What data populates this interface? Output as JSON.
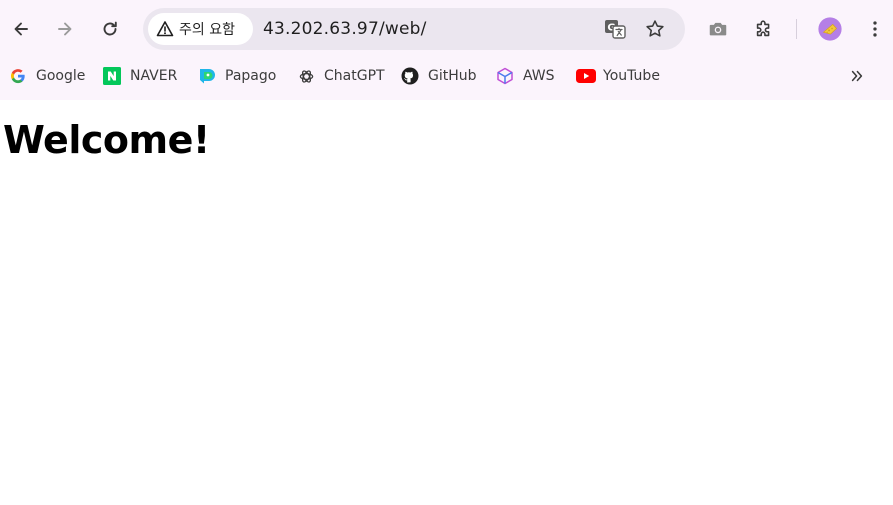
{
  "toolbar": {
    "back_icon": "arrow-left-icon",
    "forward_icon": "arrow-right-icon",
    "reload_icon": "reload-icon",
    "security_chip_label": "주의 요함",
    "security_icon": "warning-triangle-icon",
    "url": "43.202.63.97/web/",
    "translate_icon": "translate-icon",
    "bookmark_star_icon": "star-icon",
    "screenshot_icon": "camera-icon",
    "extensions_icon": "puzzle-icon",
    "profile_icon": "avatar",
    "menu_icon": "kebab-menu-icon"
  },
  "bookmarks": [
    {
      "label": "Google",
      "icon": "google-icon"
    },
    {
      "label": "NAVER",
      "icon": "naver-icon"
    },
    {
      "label": "Papago",
      "icon": "papago-icon"
    },
    {
      "label": "ChatGPT",
      "icon": "chatgpt-icon"
    },
    {
      "label": "GitHub",
      "icon": "github-icon"
    },
    {
      "label": "AWS",
      "icon": "aws-icon"
    },
    {
      "label": "YouTube",
      "icon": "youtube-icon"
    }
  ],
  "page": {
    "heading": "Welcome!"
  },
  "colors": {
    "toolbar_bg": "#fbf4fc",
    "omnibox_bg": "#ebe6ef",
    "naver_green": "#03c75a",
    "youtube_red": "#ff0000",
    "avatar_purple": "#b57fe6"
  }
}
